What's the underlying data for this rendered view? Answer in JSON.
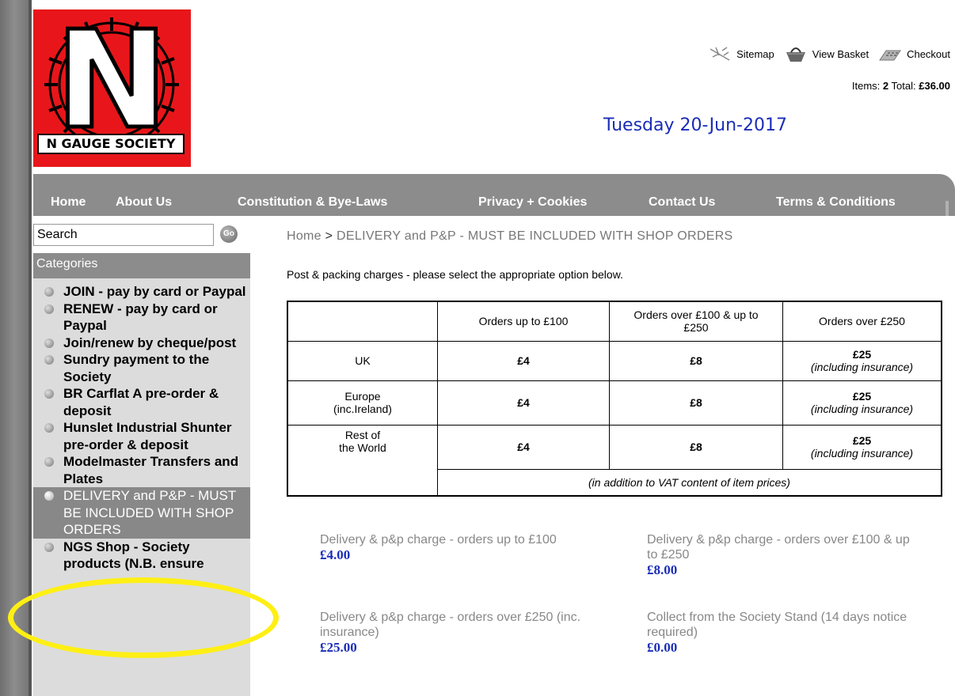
{
  "logo": {
    "text": "N GAUGE SOCIETY",
    "letter": "N"
  },
  "header": {
    "links": [
      {
        "label": "Sitemap",
        "icon": "sitemap-icon"
      },
      {
        "label": "View Basket",
        "icon": "basket-icon"
      },
      {
        "label": "Checkout",
        "icon": "checkout-icon"
      }
    ],
    "items_label": "Items:",
    "items_value": "2",
    "total_label": "Total:",
    "total_value": "£36.00",
    "date": "Tuesday 20-Jun-2017"
  },
  "nav": [
    "Home",
    "About Us",
    "Constitution & Bye-Laws",
    "Privacy + Cookies",
    "Contact Us",
    "Terms & Conditions"
  ],
  "search": {
    "value": "Search",
    "go_label": "Go"
  },
  "sidebar": {
    "header": "Categories",
    "items": [
      {
        "label": "JOIN - pay by card or Paypal"
      },
      {
        "label": "RENEW - pay by card or Paypal"
      },
      {
        "label": "Join/renew by cheque/post"
      },
      {
        "label": "Sundry payment to the Society"
      },
      {
        "label": "BR Carflat A pre-order & deposit"
      },
      {
        "label": "Hunslet Industrial Shunter pre-order & deposit"
      },
      {
        "label": "Modelmaster Transfers and Plates"
      },
      {
        "label": "DELIVERY and P&P - MUST BE INCLUDED WITH SHOP ORDERS",
        "active": true
      },
      {
        "label": "NGS Shop - Society products (N.B. ensure"
      }
    ]
  },
  "breadcrumb": {
    "home": "Home",
    "sep": ">",
    "current": "DELIVERY and P&P - MUST BE INCLUDED WITH SHOP ORDERS"
  },
  "intro": "Post & packing charges - please select the appropriate option below.",
  "table": {
    "headers": [
      "",
      "Orders up to £100",
      "Orders over £100 & up to £250",
      "Orders over £250"
    ],
    "rows": [
      {
        "region": "UK",
        "c1": "£4",
        "c2": "£8",
        "c3": "£25",
        "c3_note": "(including insurance)"
      },
      {
        "region": "Europe (inc.Ireland)",
        "c1": "£4",
        "c2": "£8",
        "c3": "£25",
        "c3_note": "(including insurance)"
      },
      {
        "region": "Rest of the World",
        "c1": "£4",
        "c2": "£8",
        "c3": "£25",
        "c3_note": "(including insurance)"
      }
    ],
    "footnote": "(in addition to VAT content of item prices)"
  },
  "products": [
    {
      "name": "Delivery & p&p charge - orders up to £100",
      "price": "£4.00"
    },
    {
      "name": "Delivery & p&p charge - orders over £100 & up to £250",
      "price": "£8.00"
    },
    {
      "name": "Delivery & p&p charge - orders over £250 (inc. insurance)",
      "price": "£25.00"
    },
    {
      "name": "Collect from the Society Stand (14 days notice required)",
      "price": "£0.00"
    }
  ],
  "colors": {
    "accent_blue": "#1a2db8",
    "nav_grey": "#8c8c8c",
    "logo_red": "#e8161a",
    "highlight_yellow": "#ffef14"
  }
}
